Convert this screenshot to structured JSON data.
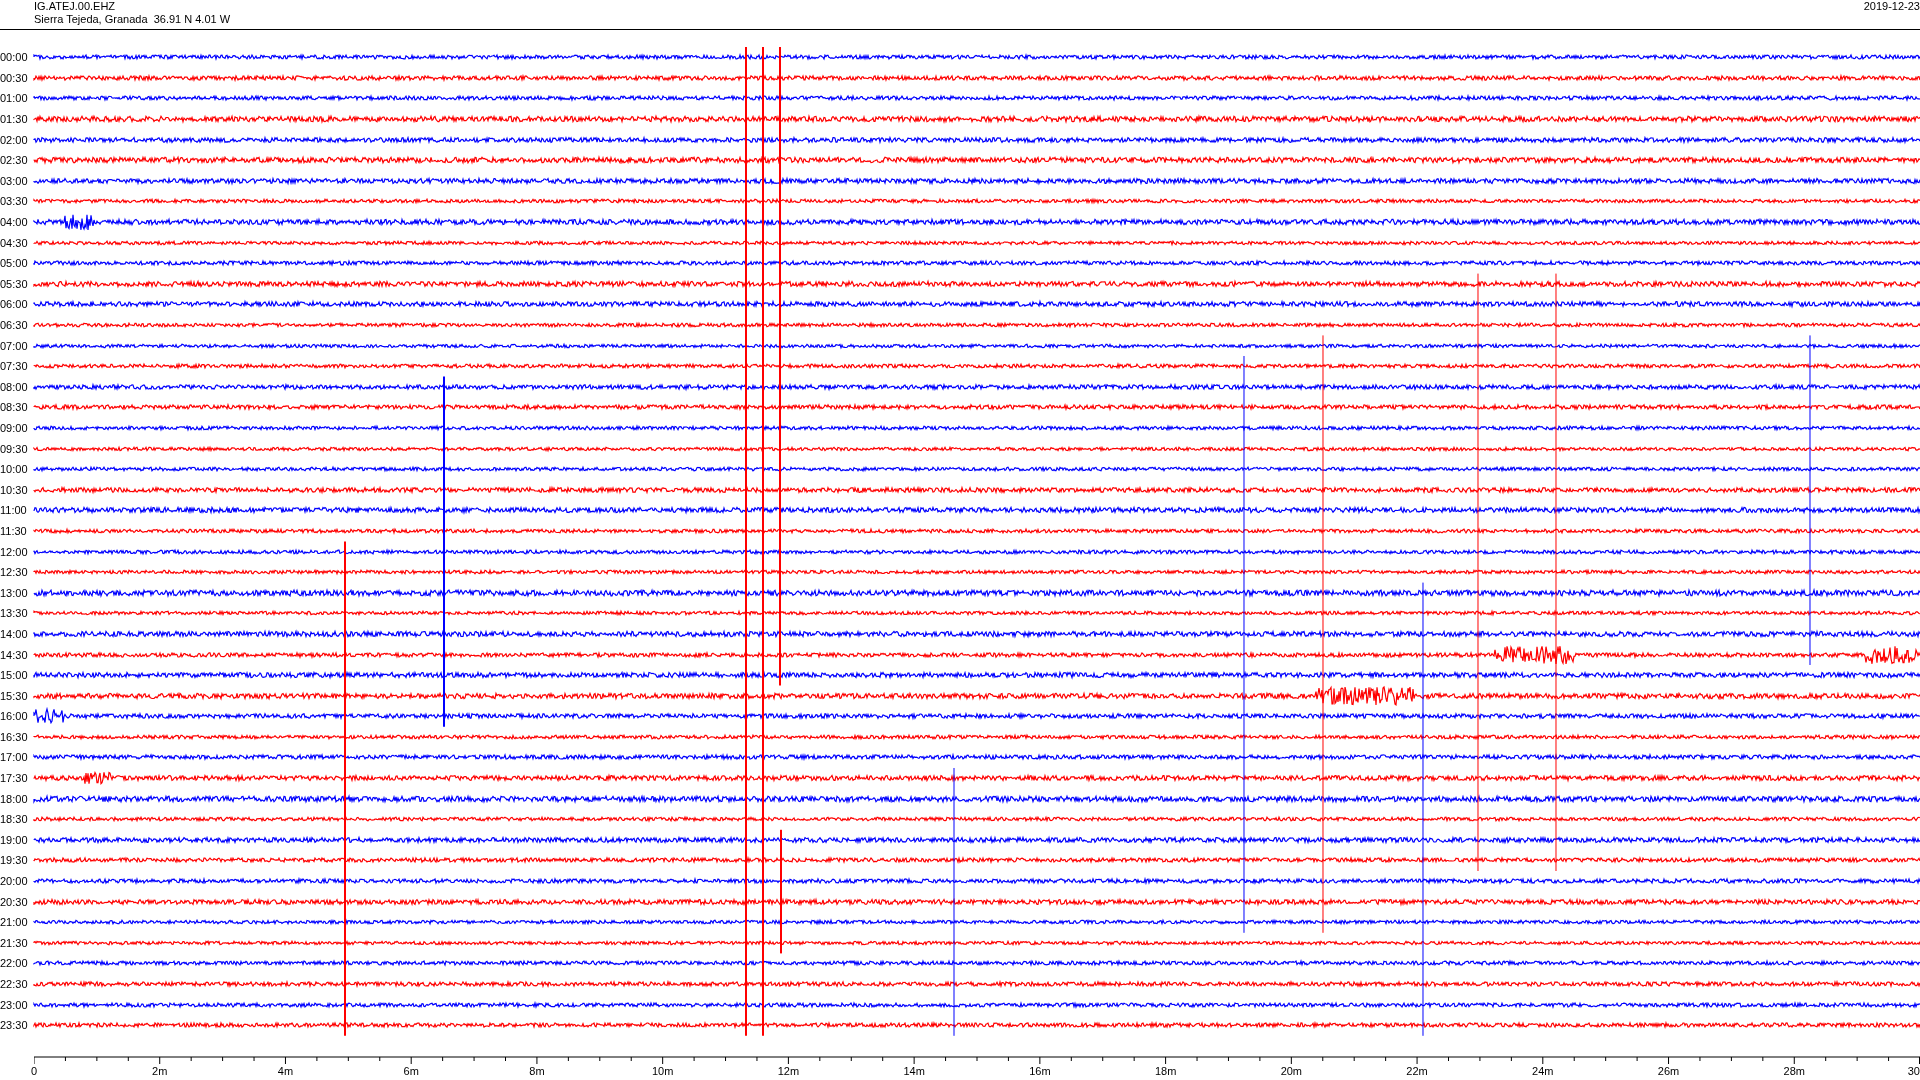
{
  "header": {
    "station": "IG.ATEJ.00.EHZ",
    "location": "Sierra Tejeda, Granada  36.91 N 4.01 W",
    "date": "2019-12-23"
  },
  "rows": [
    {
      "time": "00:00",
      "color": "#0000ff"
    },
    {
      "time": "00:30",
      "color": "#ff0000"
    },
    {
      "time": "01:00",
      "color": "#0000ff"
    },
    {
      "time": "01:30",
      "color": "#ff0000"
    },
    {
      "time": "02:00",
      "color": "#0000ff"
    },
    {
      "time": "02:30",
      "color": "#ff0000"
    },
    {
      "time": "03:00",
      "color": "#0000ff"
    },
    {
      "time": "03:30",
      "color": "#ff0000"
    },
    {
      "time": "04:00",
      "color": "#0000ff"
    },
    {
      "time": "04:30",
      "color": "#ff0000"
    },
    {
      "time": "05:00",
      "color": "#0000ff"
    },
    {
      "time": "05:30",
      "color": "#ff0000"
    },
    {
      "time": "06:00",
      "color": "#0000ff"
    },
    {
      "time": "06:30",
      "color": "#ff0000"
    },
    {
      "time": "07:00",
      "color": "#0000ff"
    },
    {
      "time": "07:30",
      "color": "#ff0000"
    },
    {
      "time": "08:00",
      "color": "#0000ff"
    },
    {
      "time": "08:30",
      "color": "#ff0000"
    },
    {
      "time": "09:00",
      "color": "#0000ff"
    },
    {
      "time": "09:30",
      "color": "#ff0000"
    },
    {
      "time": "10:00",
      "color": "#0000ff"
    },
    {
      "time": "10:30",
      "color": "#ff0000"
    },
    {
      "time": "11:00",
      "color": "#0000ff"
    },
    {
      "time": "11:30",
      "color": "#ff0000"
    },
    {
      "time": "12:00",
      "color": "#0000ff"
    },
    {
      "time": "12:30",
      "color": "#ff0000"
    },
    {
      "time": "13:00",
      "color": "#0000ff"
    },
    {
      "time": "13:30",
      "color": "#ff0000"
    },
    {
      "time": "14:00",
      "color": "#0000ff"
    },
    {
      "time": "14:30",
      "color": "#ff0000"
    },
    {
      "time": "15:00",
      "color": "#0000ff"
    },
    {
      "time": "15:30",
      "color": "#ff0000"
    },
    {
      "time": "16:00",
      "color": "#0000ff"
    },
    {
      "time": "16:30",
      "color": "#ff0000"
    },
    {
      "time": "17:00",
      "color": "#0000ff"
    },
    {
      "time": "17:30",
      "color": "#ff0000"
    },
    {
      "time": "18:00",
      "color": "#0000ff"
    },
    {
      "time": "18:30",
      "color": "#ff0000"
    },
    {
      "time": "19:00",
      "color": "#0000ff"
    },
    {
      "time": "19:30",
      "color": "#ff0000"
    },
    {
      "time": "20:00",
      "color": "#0000ff"
    },
    {
      "time": "20:30",
      "color": "#ff0000"
    },
    {
      "time": "21:00",
      "color": "#0000ff"
    },
    {
      "time": "21:30",
      "color": "#ff0000"
    },
    {
      "time": "22:00",
      "color": "#0000ff"
    },
    {
      "time": "22:30",
      "color": "#ff0000"
    },
    {
      "time": "23:00",
      "color": "#0000ff"
    },
    {
      "time": "23:30",
      "color": "#ff0000"
    }
  ],
  "axis": {
    "labels": [
      "0",
      "2m",
      "4m",
      "6m",
      "8m",
      "10m",
      "12m",
      "14m",
      "16m",
      "18m",
      "20m",
      "22m",
      "24m",
      "26m",
      "28m",
      "30"
    ]
  }
}
